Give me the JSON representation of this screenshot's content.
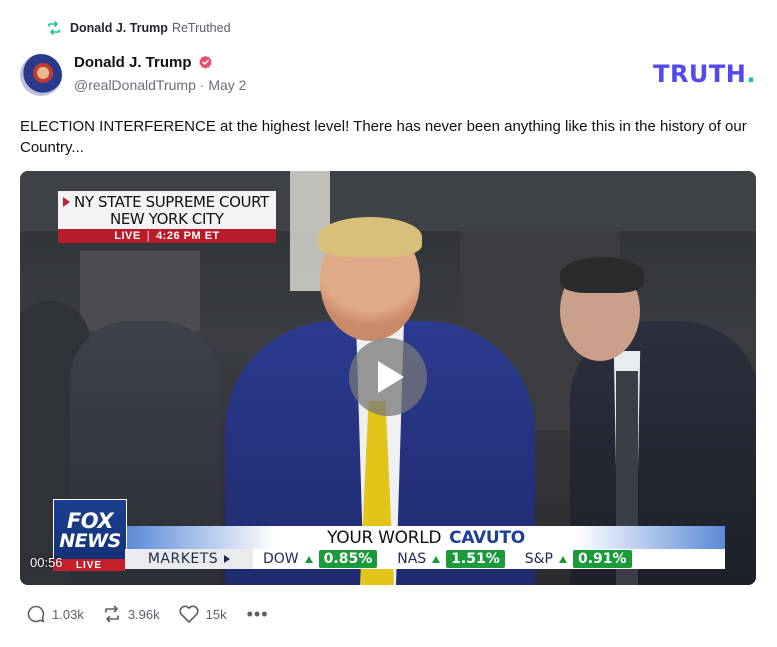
{
  "retruth": {
    "icon": "retruth-icon",
    "name": "Donald J. Trump",
    "suffix": "ReTruthed"
  },
  "author": {
    "name": "Donald J. Trump",
    "verified": "verified-badge-icon",
    "handle": "@realDonaldTrump",
    "separator": "·",
    "date": "May 2"
  },
  "brand": {
    "logo_text": "TRUTH",
    "logo_dot": ".",
    "accent_color": "#5448ee",
    "dot_color": "#1ec0a6"
  },
  "post": {
    "text": "ELECTION INTERFERENCE at the highest level! There has never been anything like this in the history of our Country..."
  },
  "video": {
    "court_line1": "NY STATE SUPREME COURT",
    "court_line2": "NEW YORK CITY",
    "live_label": "LIVE",
    "live_separator": "|",
    "live_time": "4:26 PM ET",
    "fox_line1": "FOX",
    "fox_line2": "NEWS",
    "fox_live": "LIVE",
    "show_title": "YOUR WORLD",
    "show_host": "CAVUTO",
    "markets_label": "MARKETS",
    "tickers": [
      {
        "symbol": "DOW",
        "value": "0.85%"
      },
      {
        "symbol": "NAS",
        "value": "1.51%"
      },
      {
        "symbol": "S&P",
        "value": "0.91%"
      }
    ],
    "timestamp": "00:56"
  },
  "actions": {
    "replies": "1.03k",
    "retruths": "3.96k",
    "likes": "15k",
    "more": "•••"
  }
}
